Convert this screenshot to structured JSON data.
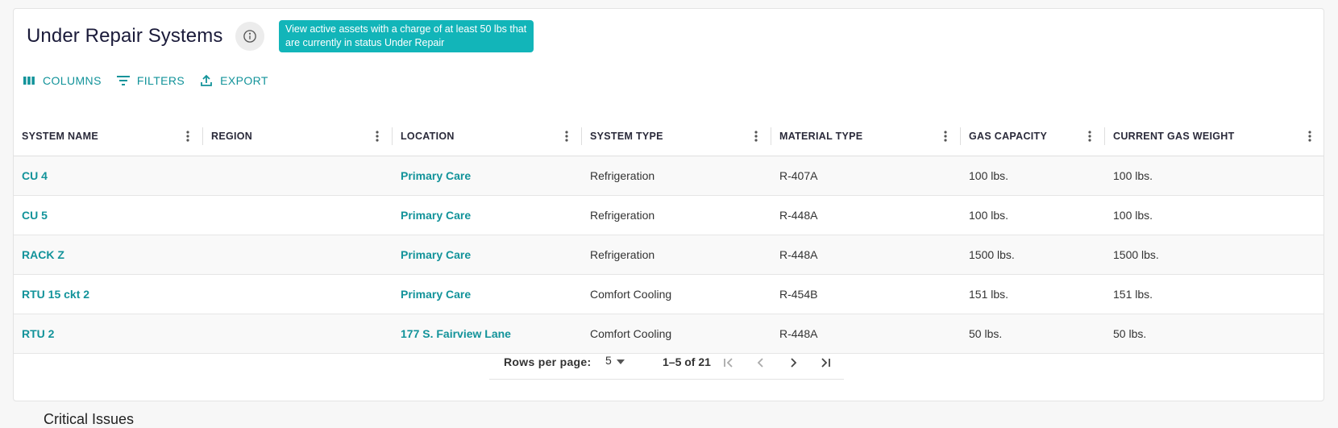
{
  "header": {
    "title": "Under Repair Systems",
    "info_icon": "info-circle-icon",
    "tooltip": "View active assets with a charge of at least 50 lbs that are currently in status Under Repair"
  },
  "toolbar": {
    "columns_label": "COLUMNS",
    "filters_label": "FILTERS",
    "export_label": "EXPORT"
  },
  "table": {
    "columns": [
      "SYSTEM NAME",
      "REGION",
      "LOCATION",
      "SYSTEM TYPE",
      "MATERIAL TYPE",
      "GAS CAPACITY",
      "CURRENT GAS WEIGHT"
    ],
    "rows": [
      [
        "CU 4",
        "",
        "Primary Care",
        "Refrigeration",
        "R-407A",
        "100 lbs.",
        "100 lbs."
      ],
      [
        "CU 5",
        "",
        "Primary Care",
        "Refrigeration",
        "R-448A",
        "100 lbs.",
        "100 lbs."
      ],
      [
        "RACK Z",
        "",
        "Primary Care",
        "Refrigeration",
        "R-448A",
        "1500 lbs.",
        "1500 lbs."
      ],
      [
        "RTU 15 ckt 2",
        "",
        "Primary Care",
        "Comfort Cooling",
        "R-454B",
        "151 lbs.",
        "151 lbs."
      ],
      [
        "RTU 2",
        "",
        "177 S. Fairview Lane",
        "Comfort Cooling",
        "R-448A",
        "50 lbs.",
        "50 lbs."
      ]
    ]
  },
  "pagination": {
    "rows_per_page_label": "Rows per page:",
    "rows_per_page": "5",
    "range": "1–5 of 21"
  },
  "next_section": {
    "title": "Critical Issues"
  },
  "colors": {
    "accent": "#12939a",
    "tooltip_bg": "#12b5b9",
    "title": "#1b1b3a"
  }
}
